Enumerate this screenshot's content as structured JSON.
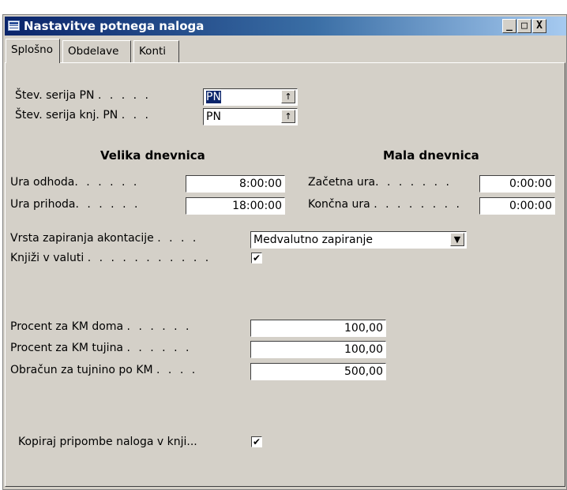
{
  "window": {
    "title": "Nastavitve potnega naloga",
    "controls": {
      "minimize": "_",
      "maximize": "□",
      "close": "X"
    }
  },
  "tabs": [
    {
      "label": "Splošno",
      "active": true
    },
    {
      "label": "Obdelave",
      "active": false
    },
    {
      "label": "Konti",
      "active": false
    }
  ],
  "general": {
    "serija_pn": {
      "label": "Štev. serija PN",
      "dots": ". . . . .",
      "value": "PN"
    },
    "serija_knj_pn": {
      "label": "Štev. serija knj. PN",
      "dots": ". . .",
      "value": "PN"
    },
    "velika_dnevnica": {
      "header": "Velika dnevnica",
      "ura_odhoda": {
        "label": "Ura odhoda",
        "dots": ". . . . . .",
        "value": "8:00:00"
      },
      "ura_prihoda": {
        "label": "Ura prihoda",
        "dots": ". . . . . .",
        "value": "18:00:00"
      }
    },
    "mala_dnevnica": {
      "header": "Mala dnevnica",
      "zacetna_ura": {
        "label": "Začetna ura",
        "dots": ". . . . . . .",
        "value": "0:00:00"
      },
      "koncna_ura": {
        "label": "Končna ura",
        "dots": ". . . . . . . .",
        "value": "0:00:00"
      }
    },
    "vrsta_zapiranja": {
      "label": "Vrsta zapiranja akontacije",
      "dots": ". . . .",
      "value": "Medvalutno zapiranje"
    },
    "knjizi_v_valuti": {
      "label": "Knjiži v valuti",
      "dots": ". . . . . . . . . . .",
      "checked": true,
      "mark": "✔"
    },
    "procent_km_doma": {
      "label": "Procent za KM doma",
      "dots": ". . . . . .",
      "value": "100,00"
    },
    "procent_km_tujina": {
      "label": "Procent za KM tujina",
      "dots": ". . . . . .",
      "value": "100,00"
    },
    "obracun_tujnino": {
      "label": "Obračun za tujnino po KM",
      "dots": ". . . .",
      "value": "500,00"
    },
    "kopiraj_pripombe": {
      "label": "Kopiraj pripombe naloga v knji...",
      "checked": true,
      "mark": "✔"
    }
  },
  "icons": {
    "lookup": "↑",
    "dropdown": "▼"
  }
}
